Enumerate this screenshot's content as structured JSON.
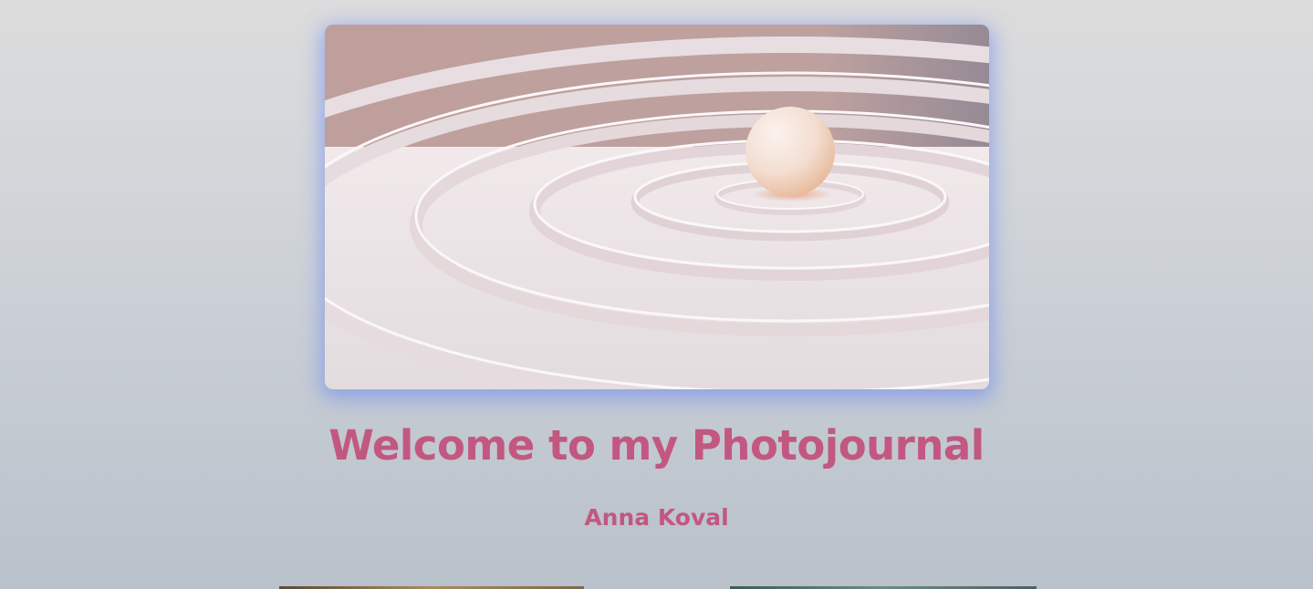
{
  "hero": {
    "image_description_icon": "ripple-sphere-image"
  },
  "header": {
    "title": "Welcome to my Photojournal",
    "author": "Anna Koval"
  },
  "colors": {
    "accent": "#c2587f",
    "glow": "#5f82f5"
  }
}
